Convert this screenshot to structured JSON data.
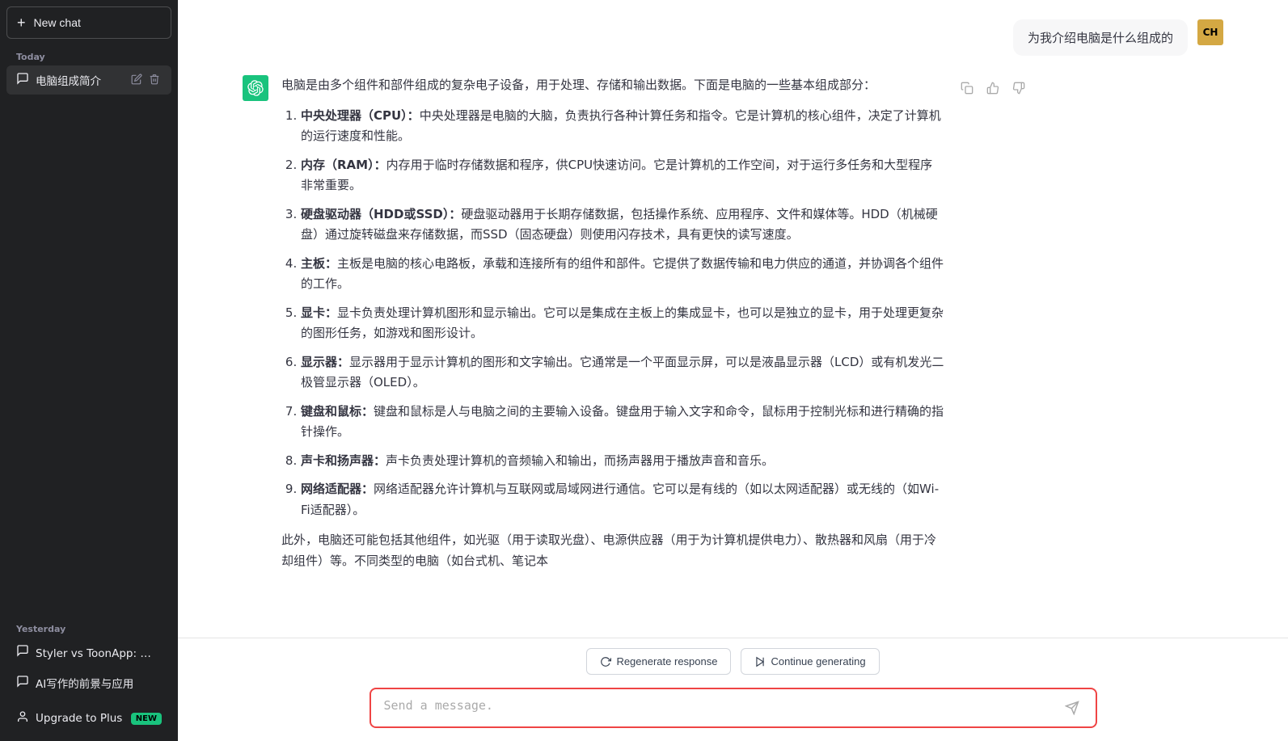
{
  "sidebar": {
    "new_chat_label": "New chat",
    "today_label": "Today",
    "yesterday_label": "Yesterday",
    "chat_today": "电脑组成简介",
    "chat_yesterday_1": "Styler vs ToonApp: 漫画脸优劣",
    "chat_yesterday_2": "AI写作的前景与应用",
    "upgrade_label": "Upgrade to Plus",
    "new_badge": "NEW"
  },
  "header": {
    "user_avatar_initials": "CH",
    "user_question": "为我介绍电脑是什么组成的"
  },
  "ai_response": {
    "intro": "电脑是由多个组件和部件组成的复杂电子设备，用于处理、存储和输出数据。下面是电脑的一些基本组成部分：",
    "items": [
      {
        "number": 1,
        "title": "中央处理器（CPU）",
        "text": "中央处理器是电脑的大脑，负责执行各种计算任务和指令。它是计算机的核心组件，决定了计算机的运行速度和性能。"
      },
      {
        "number": 2,
        "title": "内存（RAM）",
        "text": "内存用于临时存储数据和程序，供CPU快速访问。它是计算机的工作空间，对于运行多任务和大型程序非常重要。"
      },
      {
        "number": 3,
        "title": "硬盘驱动器（HDD或SSD）",
        "text": "硬盘驱动器用于长期存储数据，包括操作系统、应用程序、文件和媒体等。HDD（机械硬盘）通过旋转磁盘来存储数据，而SSD（固态硬盘）则使用闪存技术，具有更快的读写速度。"
      },
      {
        "number": 4,
        "title": "主板",
        "text": "主板是电脑的核心电路板，承载和连接所有的组件和部件。它提供了数据传输和电力供应的通道，并协调各个组件的工作。"
      },
      {
        "number": 5,
        "title": "显卡",
        "text": "显卡负责处理计算机图形和显示输出。它可以是集成在主板上的集成显卡，也可以是独立的显卡，用于处理更复杂的图形任务，如游戏和图形设计。"
      },
      {
        "number": 6,
        "title": "显示器",
        "text": "显示器用于显示计算机的图形和文字输出。它通常是一个平面显示屏，可以是液晶显示器（LCD）或有机发光二极管显示器（OLED）。"
      },
      {
        "number": 7,
        "title": "键盘和鼠标",
        "text": "键盘和鼠标是人与电脑之间的主要输入设备。键盘用于输入文字和命令，鼠标用于控制光标和进行精确的指针操作。"
      },
      {
        "number": 8,
        "title": "声卡和扬声器",
        "text": "声卡负责处理计算机的音频输入和输出，而扬声器用于播放声音和音乐。"
      },
      {
        "number": 9,
        "title": "网络适配器",
        "text": "网络适配器允许计算机与互联网或局域网进行通信。它可以是有线的（如以太网适配器）或无线的（如Wi-Fi适配器）。"
      }
    ],
    "footer": "此外，电脑还可能包括其他组件，如光驱（用于读取光盘）、电源供应器（用于为计算机提供电力）、散热器和风扇（用于冷却组件）等。不同类型的电脑（如台式机、笔记本"
  },
  "bottom_buttons": {
    "regenerate_label": "Regenerate response",
    "continue_label": "Continue generating"
  },
  "input": {
    "placeholder": "Send a message."
  }
}
